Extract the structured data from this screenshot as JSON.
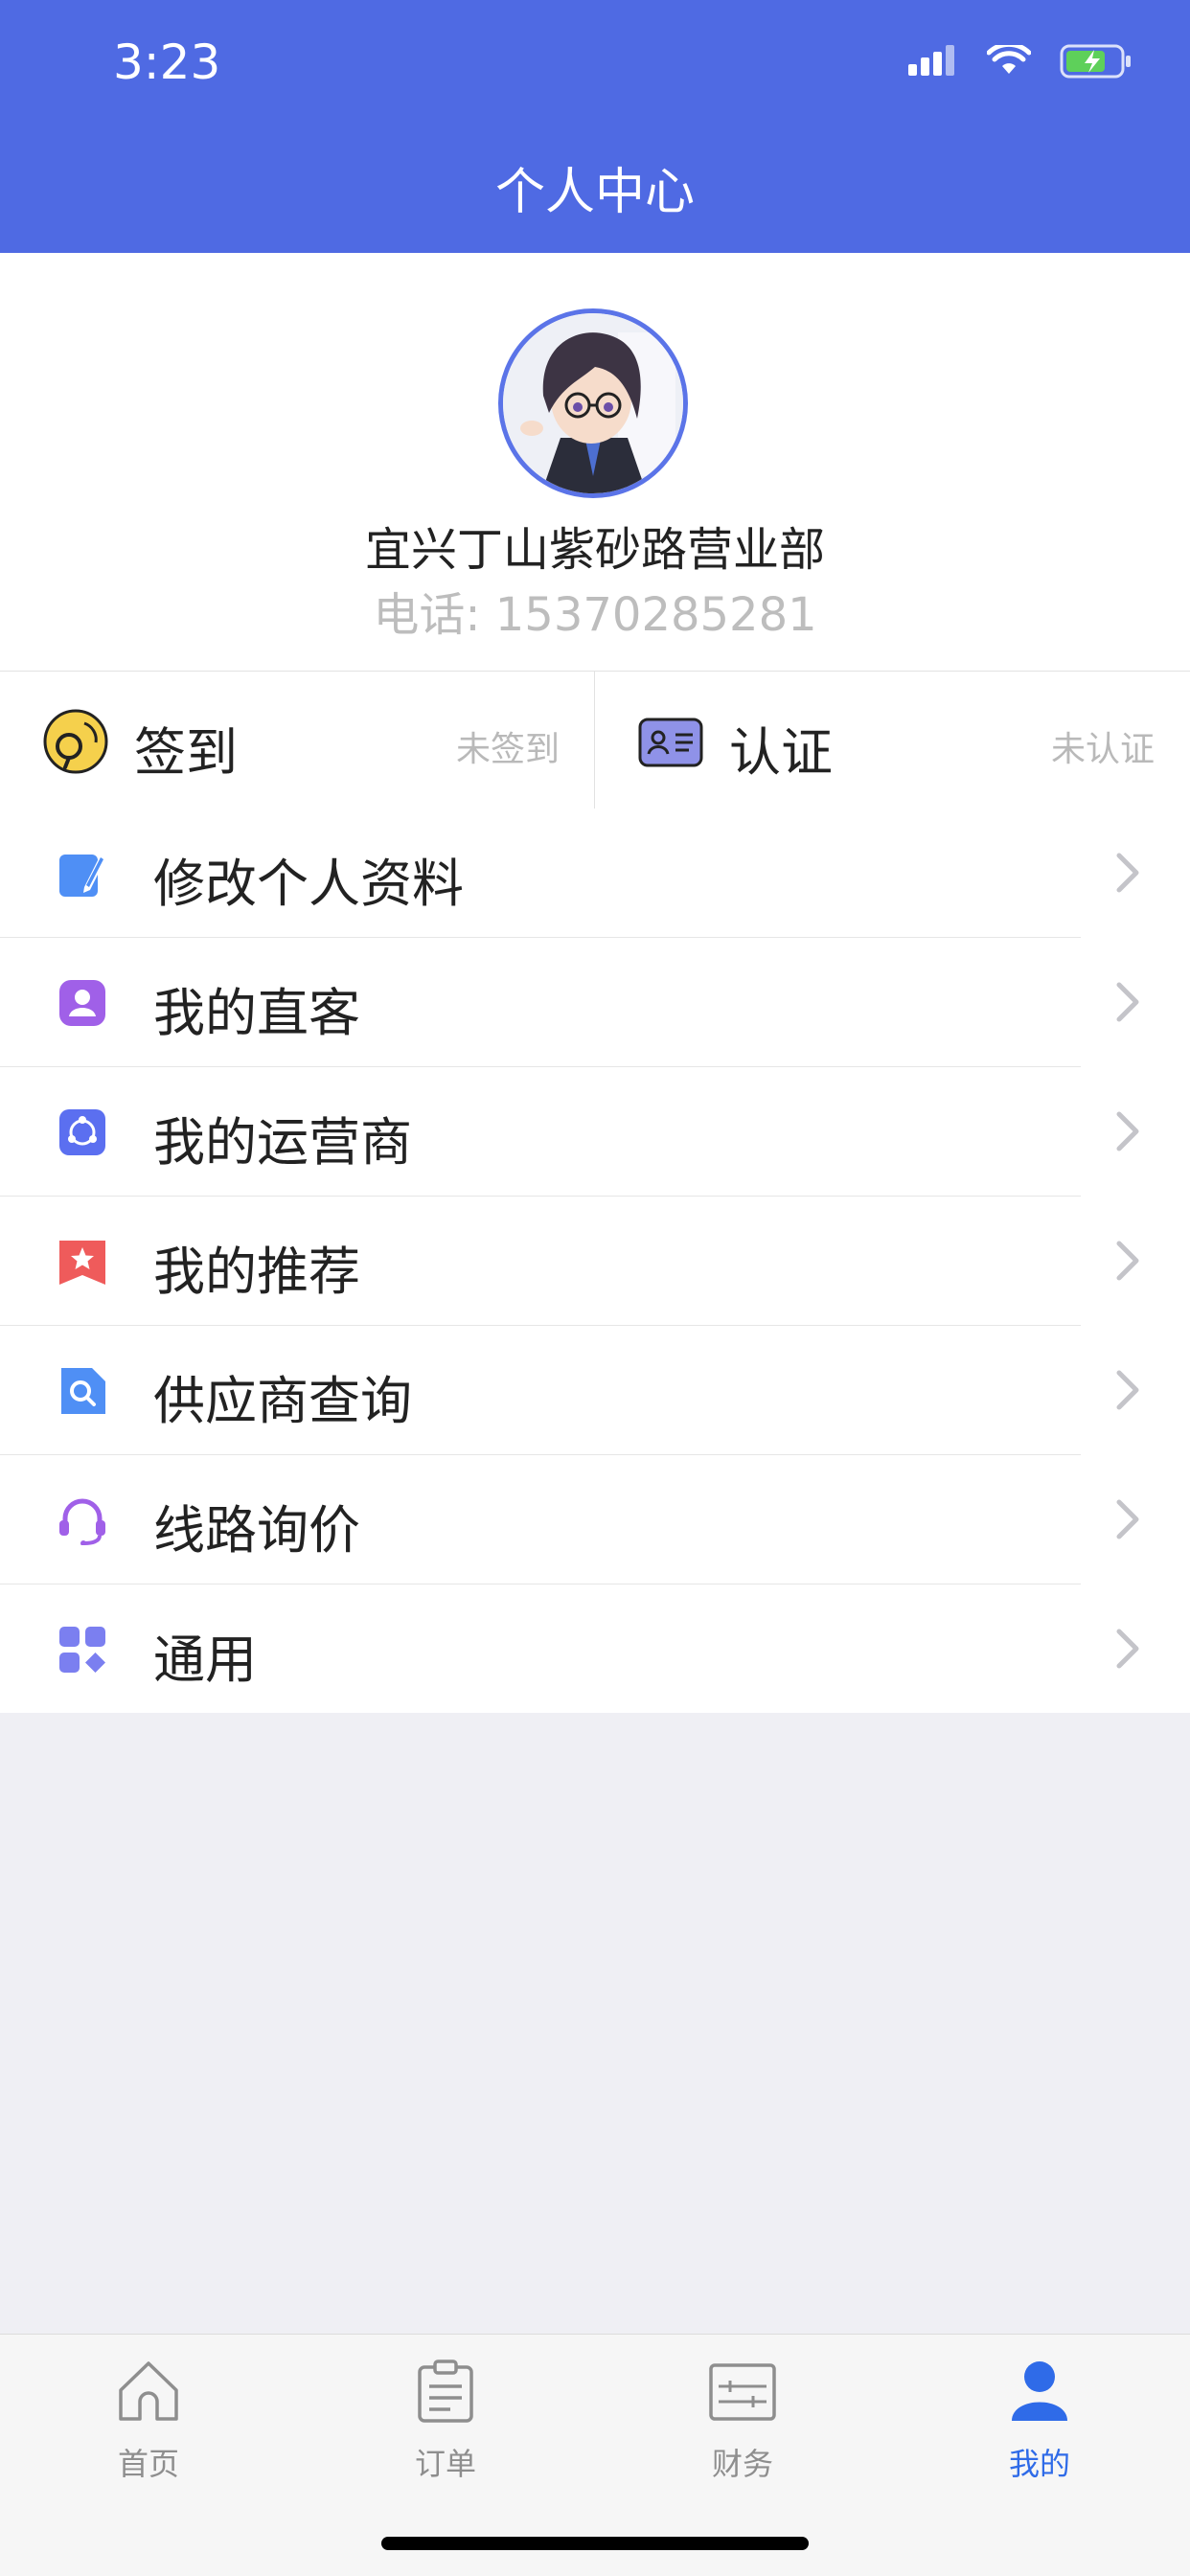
{
  "status_bar": {
    "time": "3:23"
  },
  "header": {
    "title": "个人中心"
  },
  "profile": {
    "name": "宜兴丁山紫砂路营业部",
    "phone": "电话: 15370285281"
  },
  "actions": [
    {
      "label": "签到",
      "status": "未签到",
      "icon": "sign-in-icon"
    },
    {
      "label": "认证",
      "status": "未认证",
      "icon": "id-card-icon"
    }
  ],
  "menu": [
    {
      "label": "修改个人资料",
      "icon": "edit-icon",
      "color": "#4f8ff5"
    },
    {
      "label": "我的直客",
      "icon": "user-icon",
      "color": "#a060e8"
    },
    {
      "label": "我的运营商",
      "icon": "share-icon",
      "color": "#5b6ff0"
    },
    {
      "label": "我的推荐",
      "icon": "star-bookmark-icon",
      "color": "#ef5b5b"
    },
    {
      "label": "供应商查询",
      "icon": "search-doc-icon",
      "color": "#4f8ff5"
    },
    {
      "label": "线路询价",
      "icon": "headset-icon",
      "color": "#a060e8"
    },
    {
      "label": "通用",
      "icon": "grid-icon",
      "color": "#7b7ff0"
    }
  ],
  "tabbar": {
    "tabs": [
      {
        "label": "首页",
        "icon": "home-icon",
        "active": false
      },
      {
        "label": "订单",
        "icon": "clipboard-icon",
        "active": false
      },
      {
        "label": "财务",
        "icon": "finance-icon",
        "active": false
      },
      {
        "label": "我的",
        "icon": "person-icon",
        "active": true
      }
    ],
    "active_color": "#2f6be8"
  },
  "colors": {
    "header_bg": "#4f6ae3",
    "page_bg": "#efeff4"
  }
}
